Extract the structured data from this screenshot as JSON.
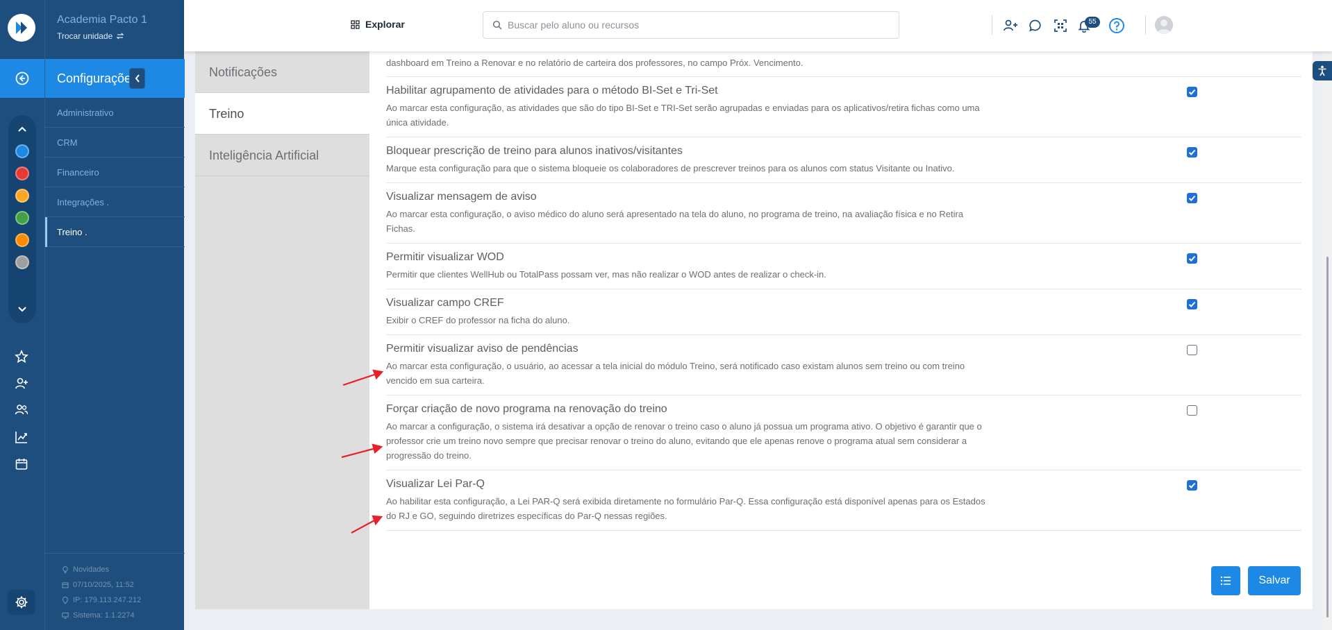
{
  "sidebar": {
    "academy_name": "Academia Pacto 1",
    "switch_unit": "Trocar unidade",
    "section_title": "Configurações",
    "items": [
      {
        "label": "Administrativo"
      },
      {
        "label": "CRM"
      },
      {
        "label": "Financeiro"
      },
      {
        "label": "Integrações ."
      },
      {
        "label": "Treino ."
      }
    ],
    "footer": {
      "news": "Novidades",
      "datetime": "07/10/2025, 11:52",
      "ip": "IP: 179.113.247.212",
      "system": "Sistema: 1.1.2274"
    }
  },
  "rail": {
    "module_colors": [
      "#1e88e5",
      "#e53935",
      "#f9a825",
      "#43a047",
      "#fb8c00",
      "#9e9e9e"
    ],
    "icons": [
      "star-icon",
      "user-plus-icon",
      "users-icon",
      "chart-icon",
      "calendar-icon"
    ]
  },
  "topbar": {
    "explore_label": "Explorar",
    "search_placeholder": "Buscar pelo aluno ou recursos",
    "notification_count": "55"
  },
  "tabs": [
    {
      "label": "Notificações"
    },
    {
      "label": "Treino"
    },
    {
      "label": "Inteligência Artificial"
    }
  ],
  "settings": {
    "partial_top_desc": "dashboard em Treino a Renovar e no relatório de carteira dos professores, no campo Próx. Vencimento.",
    "items": [
      {
        "title": "Habilitar agrupamento de atividades para o método BI-Set e Tri-Set",
        "desc": "Ao marcar esta configuração, as atividades que são do tipo BI-Set e TRI-Set serão agrupadas e enviadas para os aplicativos/retira fichas como uma única atividade.",
        "checked": true
      },
      {
        "title": "Bloquear prescrição de treino para alunos inativos/visitantes",
        "desc": "Marque esta configuração para que o sistema bloqueie os colaboradores de prescrever treinos para os alunos com status Visitante ou Inativo.",
        "checked": true
      },
      {
        "title": "Visualizar mensagem de aviso",
        "desc": "Ao marcar esta configuração, o aviso médico do aluno será apresentado na tela do aluno, no programa de treino, na avaliação física e no Retira Fichas.",
        "checked": true
      },
      {
        "title": "Permitir visualizar WOD",
        "desc": "Permitir que clientes WellHub ou TotalPass possam ver, mas não realizar o WOD antes de realizar o check-in.",
        "checked": true
      },
      {
        "title": "Visualizar campo CREF",
        "desc": "Exibir o CREF do professor na ficha do aluno.",
        "checked": true
      },
      {
        "title": "Permitir visualizar aviso de pendências",
        "desc": "Ao marcar esta configuração, o usuário, ao acessar a tela inicial do módulo Treino, será notificado caso existam alunos sem treino ou com treino vencido em sua carteira.",
        "checked": false
      },
      {
        "title": "Forçar criação de novo programa na renovação do treino",
        "desc": "Ao marcar a configuração, o sistema irá desativar a opção de renovar o treino caso o aluno já possua um programa ativo. O objetivo é garantir que o professor crie um treino novo sempre que precisar renovar o treino do aluno, evitando que ele apenas renove o programa atual sem considerar a progressão do treino.",
        "checked": false
      },
      {
        "title": "Visualizar Lei Par-Q",
        "desc": "Ao habilitar esta configuração, a Lei PAR-Q será exibida diretamente no formulário Par-Q. Essa configuração está disponível apenas para os Estados do RJ e GO, seguindo diretrizes específicas do Par-Q nessas regiões.",
        "checked": true
      }
    ]
  },
  "actions": {
    "save_label": "Salvar"
  },
  "colors": {
    "brand_dark": "#1d4e7e",
    "accent": "#1e88e5",
    "annotation_arrow": "#e8202a"
  }
}
